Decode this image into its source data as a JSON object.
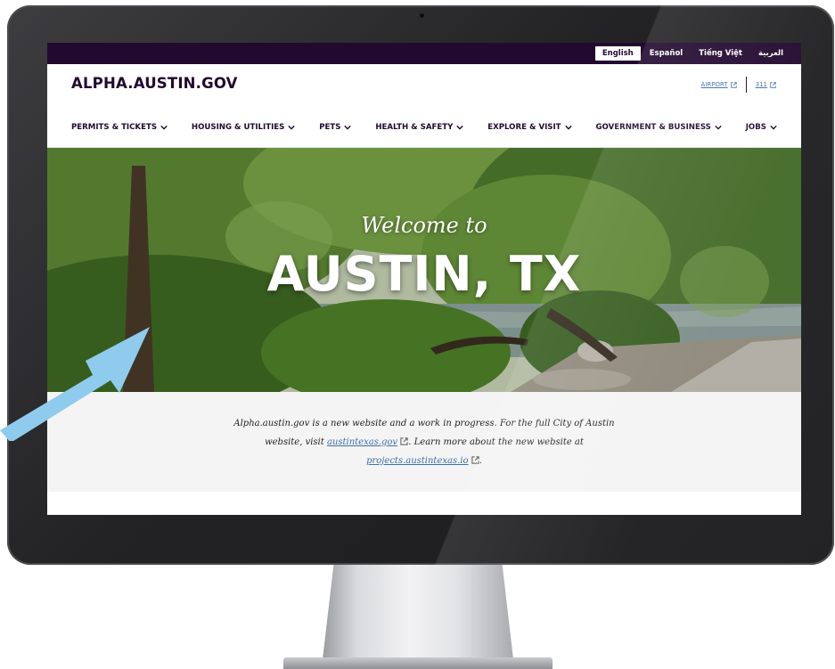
{
  "lang_bar": {
    "languages": [
      "English",
      "Español",
      "Tiếng Việt",
      "العربية"
    ],
    "active_index": 0
  },
  "header": {
    "site_title": "ALPHA.AUSTIN.GOV",
    "utility_links": [
      "AIRPORT",
      "311"
    ]
  },
  "nav": {
    "items": [
      "PERMITS & TICKETS",
      "HOUSING & UTILITIES",
      "PETS",
      "HEALTH & SAFETY",
      "EXPLORE & VISIT",
      "GOVERNMENT & BUSINESS",
      "JOBS"
    ]
  },
  "hero": {
    "welcome": "Welcome to",
    "city": "AUSTIN, TX"
  },
  "notice": {
    "part1": "Alpha.austin.gov is a new website and a work in progress. For the full City of Austin website, visit ",
    "link1": "austintexas.gov",
    "part2": ". Learn more about the new website at ",
    "link2": "projects.austintexas.io",
    "part3": "."
  },
  "colors": {
    "lang_bar_bg": "#22092f",
    "brand_text": "#22092f",
    "link": "#3e6fa8",
    "notice_bg": "#f4f4f4",
    "arrow": "#8fcbec",
    "bezel": "#232325"
  },
  "icons": {
    "external": "external-link-icon",
    "dropdown": "chevron-down-icon"
  }
}
